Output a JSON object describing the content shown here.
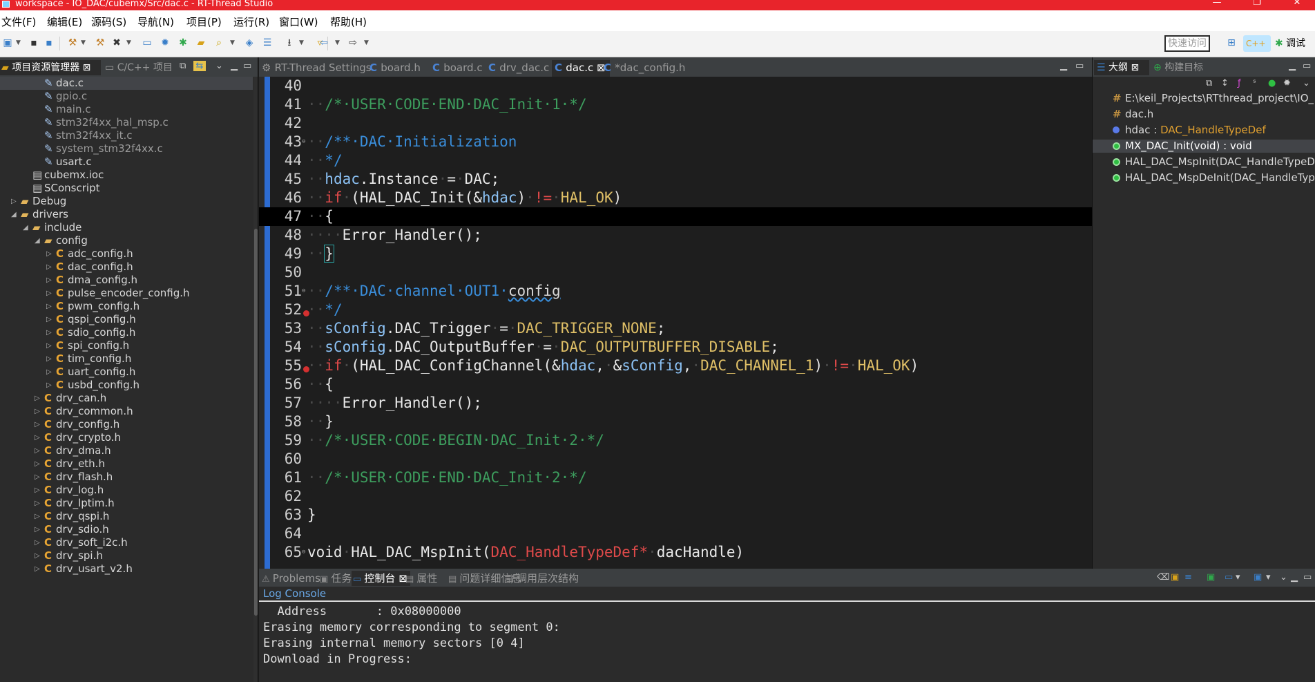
{
  "window": {
    "title": "workspace - IO_DAC/cubemx/Src/dac.c - RT-Thread Studio",
    "controls": [
      "—",
      "❐",
      "✕"
    ]
  },
  "menu": [
    "文件(F)",
    "编辑(E)",
    "源码(S)",
    "导航(N)",
    "项目(P)",
    "运行(R)",
    "窗口(W)",
    "帮助(H)"
  ],
  "toolbar": {
    "quick_access_placeholder": "快速访问",
    "debug_label": "调试",
    "cpp_label": "C++"
  },
  "left_panel": {
    "tabs": [
      {
        "label": "项目资源管理器 ⊠",
        "active": true
      },
      {
        "label": "C/C++ 项目",
        "active": false
      }
    ],
    "tree": [
      {
        "indent": 4,
        "icon": "file",
        "label": "dac.c",
        "twist": "",
        "selected": true
      },
      {
        "indent": 4,
        "icon": "file",
        "label": "gpio.c",
        "twist": "",
        "muted": true
      },
      {
        "indent": 4,
        "icon": "file",
        "label": "main.c",
        "twist": "",
        "muted": true
      },
      {
        "indent": 4,
        "icon": "file",
        "label": "stm32f4xx_hal_msp.c",
        "twist": "",
        "muted": true
      },
      {
        "indent": 4,
        "icon": "file",
        "label": "stm32f4xx_it.c",
        "twist": "",
        "muted": true
      },
      {
        "indent": 4,
        "icon": "file",
        "label": "system_stm32f4xx.c",
        "twist": "",
        "muted": true
      },
      {
        "indent": 4,
        "icon": "file",
        "label": "usart.c",
        "twist": ""
      },
      {
        "indent": 3,
        "icon": "doc",
        "label": "cubemx.ioc",
        "twist": ""
      },
      {
        "indent": 3,
        "icon": "doc",
        "label": "SConscript",
        "twist": ""
      },
      {
        "indent": 2,
        "icon": "folder",
        "label": "Debug",
        "twist": "▷"
      },
      {
        "indent": 2,
        "icon": "folder",
        "label": "drivers",
        "twist": "◢"
      },
      {
        "indent": 3,
        "icon": "folder",
        "label": "include",
        "twist": "◢"
      },
      {
        "indent": 4,
        "icon": "folder",
        "label": "config",
        "twist": "◢"
      },
      {
        "indent": 5,
        "icon": "c",
        "label": "adc_config.h",
        "twist": "▷"
      },
      {
        "indent": 5,
        "icon": "c",
        "label": "dac_config.h",
        "twist": "▷"
      },
      {
        "indent": 5,
        "icon": "c",
        "label": "dma_config.h",
        "twist": "▷"
      },
      {
        "indent": 5,
        "icon": "c",
        "label": "pulse_encoder_config.h",
        "twist": "▷"
      },
      {
        "indent": 5,
        "icon": "c",
        "label": "pwm_config.h",
        "twist": "▷"
      },
      {
        "indent": 5,
        "icon": "c",
        "label": "qspi_config.h",
        "twist": "▷"
      },
      {
        "indent": 5,
        "icon": "c",
        "label": "sdio_config.h",
        "twist": "▷"
      },
      {
        "indent": 5,
        "icon": "c",
        "label": "spi_config.h",
        "twist": "▷"
      },
      {
        "indent": 5,
        "icon": "c",
        "label": "tim_config.h",
        "twist": "▷"
      },
      {
        "indent": 5,
        "icon": "c",
        "label": "uart_config.h",
        "twist": "▷"
      },
      {
        "indent": 5,
        "icon": "c",
        "label": "usbd_config.h",
        "twist": "▷"
      },
      {
        "indent": 4,
        "icon": "c",
        "label": "drv_can.h",
        "twist": "▷"
      },
      {
        "indent": 4,
        "icon": "c",
        "label": "drv_common.h",
        "twist": "▷"
      },
      {
        "indent": 4,
        "icon": "c",
        "label": "drv_config.h",
        "twist": "▷"
      },
      {
        "indent": 4,
        "icon": "c",
        "label": "drv_crypto.h",
        "twist": "▷"
      },
      {
        "indent": 4,
        "icon": "c",
        "label": "drv_dma.h",
        "twist": "▷"
      },
      {
        "indent": 4,
        "icon": "c",
        "label": "drv_eth.h",
        "twist": "▷"
      },
      {
        "indent": 4,
        "icon": "c",
        "label": "drv_flash.h",
        "twist": "▷"
      },
      {
        "indent": 4,
        "icon": "c",
        "label": "drv_log.h",
        "twist": "▷"
      },
      {
        "indent": 4,
        "icon": "c",
        "label": "drv_lptim.h",
        "twist": "▷"
      },
      {
        "indent": 4,
        "icon": "c",
        "label": "drv_qspi.h",
        "twist": "▷"
      },
      {
        "indent": 4,
        "icon": "c",
        "label": "drv_sdio.h",
        "twist": "▷"
      },
      {
        "indent": 4,
        "icon": "c",
        "label": "drv_soft_i2c.h",
        "twist": "▷"
      },
      {
        "indent": 4,
        "icon": "c",
        "label": "drv_spi.h",
        "twist": "▷"
      },
      {
        "indent": 4,
        "icon": "c",
        "label": "drv_usart_v2.h",
        "twist": "▷"
      }
    ]
  },
  "editor": {
    "tabs": [
      {
        "label": "RT-Thread Settings",
        "icon": "settings-icon"
      },
      {
        "label": "board.h",
        "icon": "c-file-icon"
      },
      {
        "label": "board.c",
        "icon": "c-file-icon"
      },
      {
        "label": "drv_dac.c",
        "icon": "c-file-icon"
      },
      {
        "label": "dac.c ⊠",
        "icon": "c-file-icon",
        "active": true
      },
      {
        "label": "*dac_config.h",
        "icon": "c-file-icon"
      }
    ],
    "lines": [
      {
        "n": "40",
        "parts": []
      },
      {
        "n": "41",
        "parts": [
          [
            "ws",
            "··"
          ],
          [
            "cmt",
            "/*·USER·CODE·END·DAC_Init·1·*/"
          ]
        ]
      },
      {
        "n": "42",
        "parts": []
      },
      {
        "n": "43",
        "fold": true,
        "parts": [
          [
            "ws",
            "··"
          ],
          [
            "doc",
            "/**·DAC·Initialization"
          ]
        ]
      },
      {
        "n": "44",
        "parts": [
          [
            "ws",
            "··"
          ],
          [
            "doc",
            "*/"
          ]
        ]
      },
      {
        "n": "45",
        "parts": [
          [
            "ws",
            "··"
          ],
          [
            "fld",
            "hdac"
          ],
          [
            "id",
            ".Instance"
          ],
          [
            "ws",
            "·"
          ],
          [
            "id",
            "="
          ],
          [
            "ws",
            "·"
          ],
          [
            "id",
            "DAC;"
          ]
        ]
      },
      {
        "n": "46",
        "parts": [
          [
            "ws",
            "··"
          ],
          [
            "kw",
            "if"
          ],
          [
            "ws",
            "·"
          ],
          [
            "id",
            "(HAL_DAC_Init(&"
          ],
          [
            "fld",
            "hdac"
          ],
          [
            "id",
            ")"
          ],
          [
            "ws",
            "·"
          ],
          [
            "kw",
            "!="
          ],
          [
            "ws",
            "·"
          ],
          [
            "mac",
            "HAL_OK"
          ],
          [
            "id",
            ")"
          ]
        ]
      },
      {
        "n": "47",
        "cur": true,
        "parts": [
          [
            "ws",
            "··"
          ],
          [
            "id",
            "{"
          ]
        ]
      },
      {
        "n": "48",
        "parts": [
          [
            "ws",
            "····"
          ],
          [
            "id",
            "Error_Handler();"
          ]
        ]
      },
      {
        "n": "49",
        "parts": [
          [
            "ws",
            "··"
          ],
          [
            "brk",
            "}"
          ]
        ]
      },
      {
        "n": "50",
        "parts": []
      },
      {
        "n": "51",
        "fold": true,
        "parts": [
          [
            "ws",
            "··"
          ],
          [
            "doc",
            "/**·DAC·channel·OUT1·"
          ],
          [
            "und",
            "config"
          ]
        ]
      },
      {
        "n": "52",
        "warn": true,
        "parts": [
          [
            "ws",
            "··"
          ],
          [
            "doc",
            "*/"
          ]
        ]
      },
      {
        "n": "53",
        "parts": [
          [
            "ws",
            "··"
          ],
          [
            "fld",
            "sConfig"
          ],
          [
            "id",
            ".DAC_Trigger"
          ],
          [
            "ws",
            "·"
          ],
          [
            "id",
            "="
          ],
          [
            "ws",
            "·"
          ],
          [
            "mac",
            "DAC_TRIGGER_NONE"
          ],
          [
            "id",
            ";"
          ]
        ]
      },
      {
        "n": "54",
        "parts": [
          [
            "ws",
            "··"
          ],
          [
            "fld",
            "sConfig"
          ],
          [
            "id",
            ".DAC_OutputBuffer"
          ],
          [
            "ws",
            "·"
          ],
          [
            "id",
            "="
          ],
          [
            "ws",
            "·"
          ],
          [
            "mac",
            "DAC_OUTPUTBUFFER_DISABLE"
          ],
          [
            "id",
            ";"
          ]
        ]
      },
      {
        "n": "55",
        "warn": true,
        "parts": [
          [
            "ws",
            "··"
          ],
          [
            "kw",
            "if"
          ],
          [
            "ws",
            "·"
          ],
          [
            "id",
            "(HAL_DAC_ConfigChannel(&"
          ],
          [
            "fld",
            "hdac"
          ],
          [
            "id",
            ","
          ],
          [
            "ws",
            "·"
          ],
          [
            "id",
            "&"
          ],
          [
            "fld",
            "sConfig"
          ],
          [
            "id",
            ","
          ],
          [
            "ws",
            "·"
          ],
          [
            "mac",
            "DAC_CHANNEL_1"
          ],
          [
            "id",
            ")"
          ],
          [
            "ws",
            "·"
          ],
          [
            "kw",
            "!="
          ],
          [
            "ws",
            "·"
          ],
          [
            "mac",
            "HAL_OK"
          ],
          [
            "id",
            ")"
          ]
        ]
      },
      {
        "n": "56",
        "parts": [
          [
            "ws",
            "··"
          ],
          [
            "id",
            "{"
          ]
        ]
      },
      {
        "n": "57",
        "parts": [
          [
            "ws",
            "····"
          ],
          [
            "id",
            "Error_Handler();"
          ]
        ]
      },
      {
        "n": "58",
        "parts": [
          [
            "ws",
            "··"
          ],
          [
            "id",
            "}"
          ]
        ]
      },
      {
        "n": "59",
        "parts": [
          [
            "ws",
            "··"
          ],
          [
            "cmt",
            "/*·USER·CODE·BEGIN·DAC_Init·2·*/"
          ]
        ]
      },
      {
        "n": "60",
        "parts": []
      },
      {
        "n": "61",
        "parts": [
          [
            "ws",
            "··"
          ],
          [
            "cmt",
            "/*·USER·CODE·END·DAC_Init·2·*/"
          ]
        ]
      },
      {
        "n": "62",
        "parts": []
      },
      {
        "n": "63",
        "parts": [
          [
            "id",
            "}"
          ]
        ]
      },
      {
        "n": "64",
        "parts": []
      },
      {
        "n": "65",
        "fold": true,
        "parts": [
          [
            "id",
            "void"
          ],
          [
            "ws",
            "·"
          ],
          [
            "id",
            "HAL_DAC_MspInit("
          ],
          [
            "typ",
            "DAC_HandleTypeDef*"
          ],
          [
            "ws",
            "·"
          ],
          [
            "id",
            "dacHandle)"
          ]
        ]
      }
    ]
  },
  "outline": {
    "tabs": [
      {
        "label": "大纲 ⊠",
        "active": true
      },
      {
        "label": "构建目标",
        "active": false
      }
    ],
    "items": [
      {
        "icon": "hash",
        "label": "E:\\keil_Projects\\RTthread_project\\IO_"
      },
      {
        "icon": "hash",
        "label": "dac.h"
      },
      {
        "icon": "blue",
        "label": "hdac : ",
        "type": "DAC_HandleTypeDef"
      },
      {
        "icon": "green",
        "label": "MX_DAC_Init(void) : void",
        "selected": true
      },
      {
        "icon": "green",
        "label": "HAL_DAC_MspInit(DAC_HandleTypeD"
      },
      {
        "icon": "green",
        "label": "HAL_DAC_MspDeInit(DAC_HandleTyp"
      }
    ]
  },
  "console": {
    "tabs": [
      {
        "label": "Problems"
      },
      {
        "label": "任务"
      },
      {
        "label": "控制台 ⊠",
        "active": true
      },
      {
        "label": "属性"
      },
      {
        "label": "问题详细信息"
      },
      {
        "label": "调用层次结构"
      }
    ],
    "title": "Log Console",
    "lines": [
      "  Address       : 0x08000000",
      "Erasing memory corresponding to segment 0:",
      "Erasing internal memory sectors [0 4]",
      "Download in Progress:"
    ]
  }
}
